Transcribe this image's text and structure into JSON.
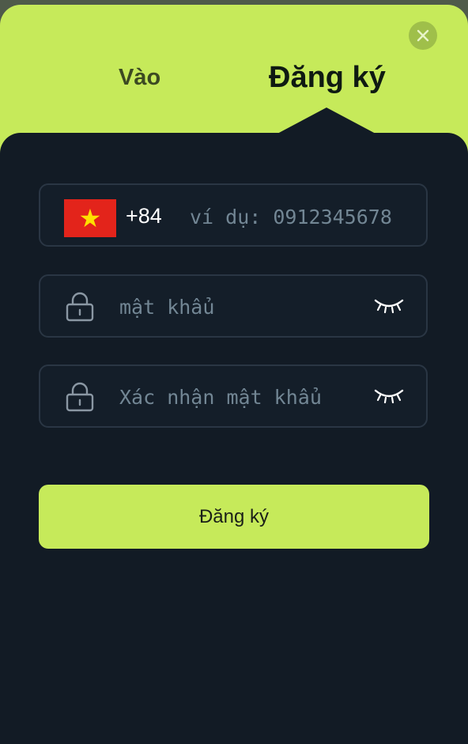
{
  "tabs": {
    "login_label": "Vào",
    "register_label": "Đăng ký"
  },
  "close_icon": "close-icon",
  "phone": {
    "flag_icon": "vietnam-flag-icon",
    "flag_star": "★",
    "dial_code": "+84",
    "placeholder": "ví dụ: 0912345678"
  },
  "password": {
    "icon": "lock-icon",
    "placeholder": "mật khẩu",
    "toggle_icon": "eye-closed-icon"
  },
  "confirm_password": {
    "icon": "lock-icon",
    "placeholder": "Xác nhận mật khẩu",
    "toggle_icon": "eye-closed-icon"
  },
  "submit_label": "Đăng ký",
  "colors": {
    "accent": "#c6ea5a",
    "panel": "#121b25",
    "field_border": "#2a3644",
    "placeholder": "#728694"
  }
}
